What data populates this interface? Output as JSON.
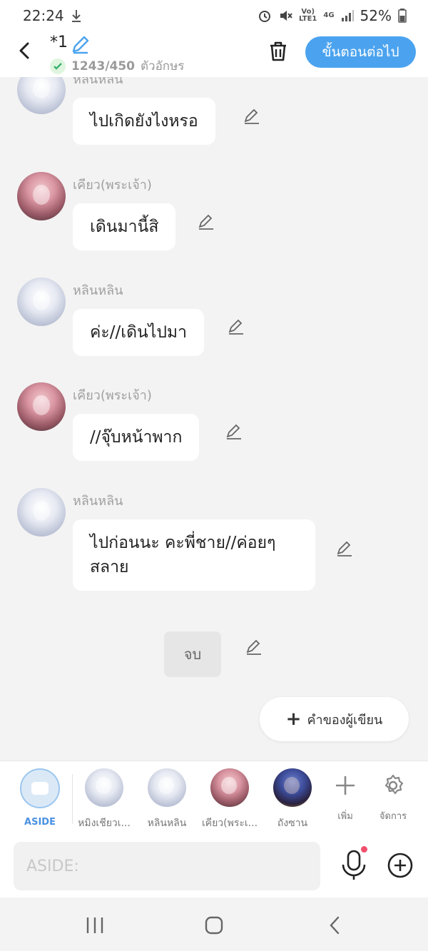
{
  "status_bar": {
    "time": "22:24",
    "battery": "52%",
    "net_small_top": "Vo)",
    "net_small_bottom": "LTE1",
    "net_type": "4G"
  },
  "header": {
    "title": "*1",
    "char_count": "1243/450",
    "char_unit": "ตัวอักษร",
    "next_label": "ขั้นตอนต่อไป"
  },
  "messages": [
    {
      "sender": "หลินหลิน",
      "text": "ไปเกิดยังไงหรอ"
    },
    {
      "sender": "เคียว(พระเจ้า)",
      "text": "เดินมานี้สิ"
    },
    {
      "sender": "หลินหลิน",
      "text": "ค่ะ//เดินไปมา"
    },
    {
      "sender": "เคียว(พระเจ้า)",
      "text": "//จุ๊บหน้าพาก"
    },
    {
      "sender": "หลินหลิน",
      "text": "ไปก่อนนะ คะพี่ชาย//ค่อยๆ สลาย"
    }
  ],
  "end_label": "จบ",
  "author_button": "คำของผู้เขียน",
  "characters": [
    {
      "label": "ASIDE"
    },
    {
      "label": "หมิงเชียวเ..."
    },
    {
      "label": "หลินหลิน"
    },
    {
      "label": "เคียว(พระเ..."
    },
    {
      "label": "ถังซาน"
    }
  ],
  "tools": {
    "add": "เพิ่ม",
    "manage": "จัดการ"
  },
  "input": {
    "placeholder": "ASIDE:"
  },
  "colors": {
    "accent": "#4ba3ef",
    "mic_dot": "#f0506e",
    "check": "#3cb371"
  }
}
